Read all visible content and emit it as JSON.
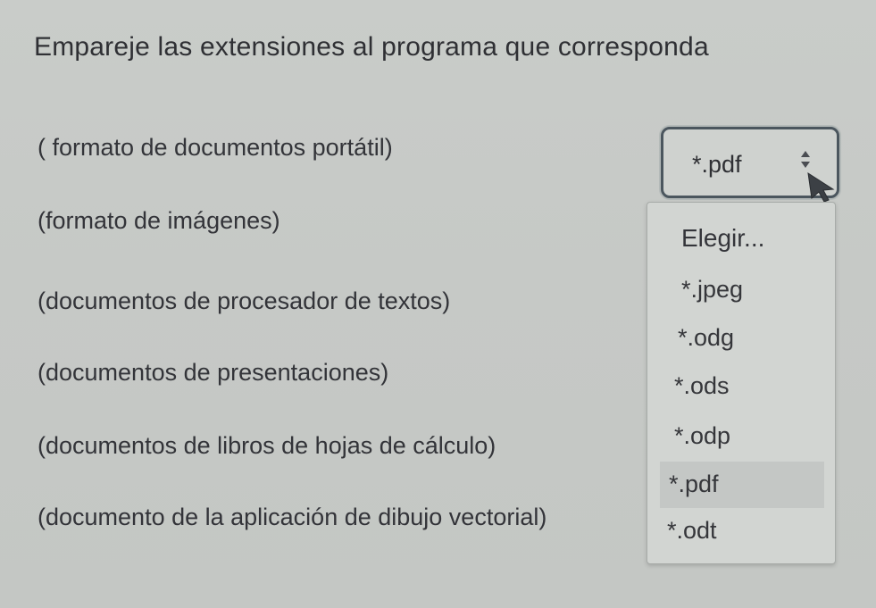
{
  "question": {
    "title": "Empareje las extensiones al programa que corresponda"
  },
  "items": [
    {
      "label": "( formato de documentos portátil)"
    },
    {
      "label": "(formato de imágenes)"
    },
    {
      "label": "(documentos de procesador de textos)"
    },
    {
      "label": "(documentos de presentaciones)"
    },
    {
      "label": "(documentos de libros de hojas de cálculo)"
    },
    {
      "label": "(documento de la aplicación de dibujo vectorial)"
    }
  ],
  "select": {
    "value": "*.pdf",
    "arrow_icon": "sort-arrows-icon",
    "cursor_icon": "mouse-pointer-icon"
  },
  "dropdown": {
    "options": [
      {
        "label": "Elegir..."
      },
      {
        "label": "*.jpeg"
      },
      {
        "label": "*.odg"
      },
      {
        "label": "*.ods"
      },
      {
        "label": "*.odp"
      },
      {
        "label": "*.pdf"
      },
      {
        "label": "*.odt"
      }
    ],
    "highlighted": "*.pdf"
  }
}
